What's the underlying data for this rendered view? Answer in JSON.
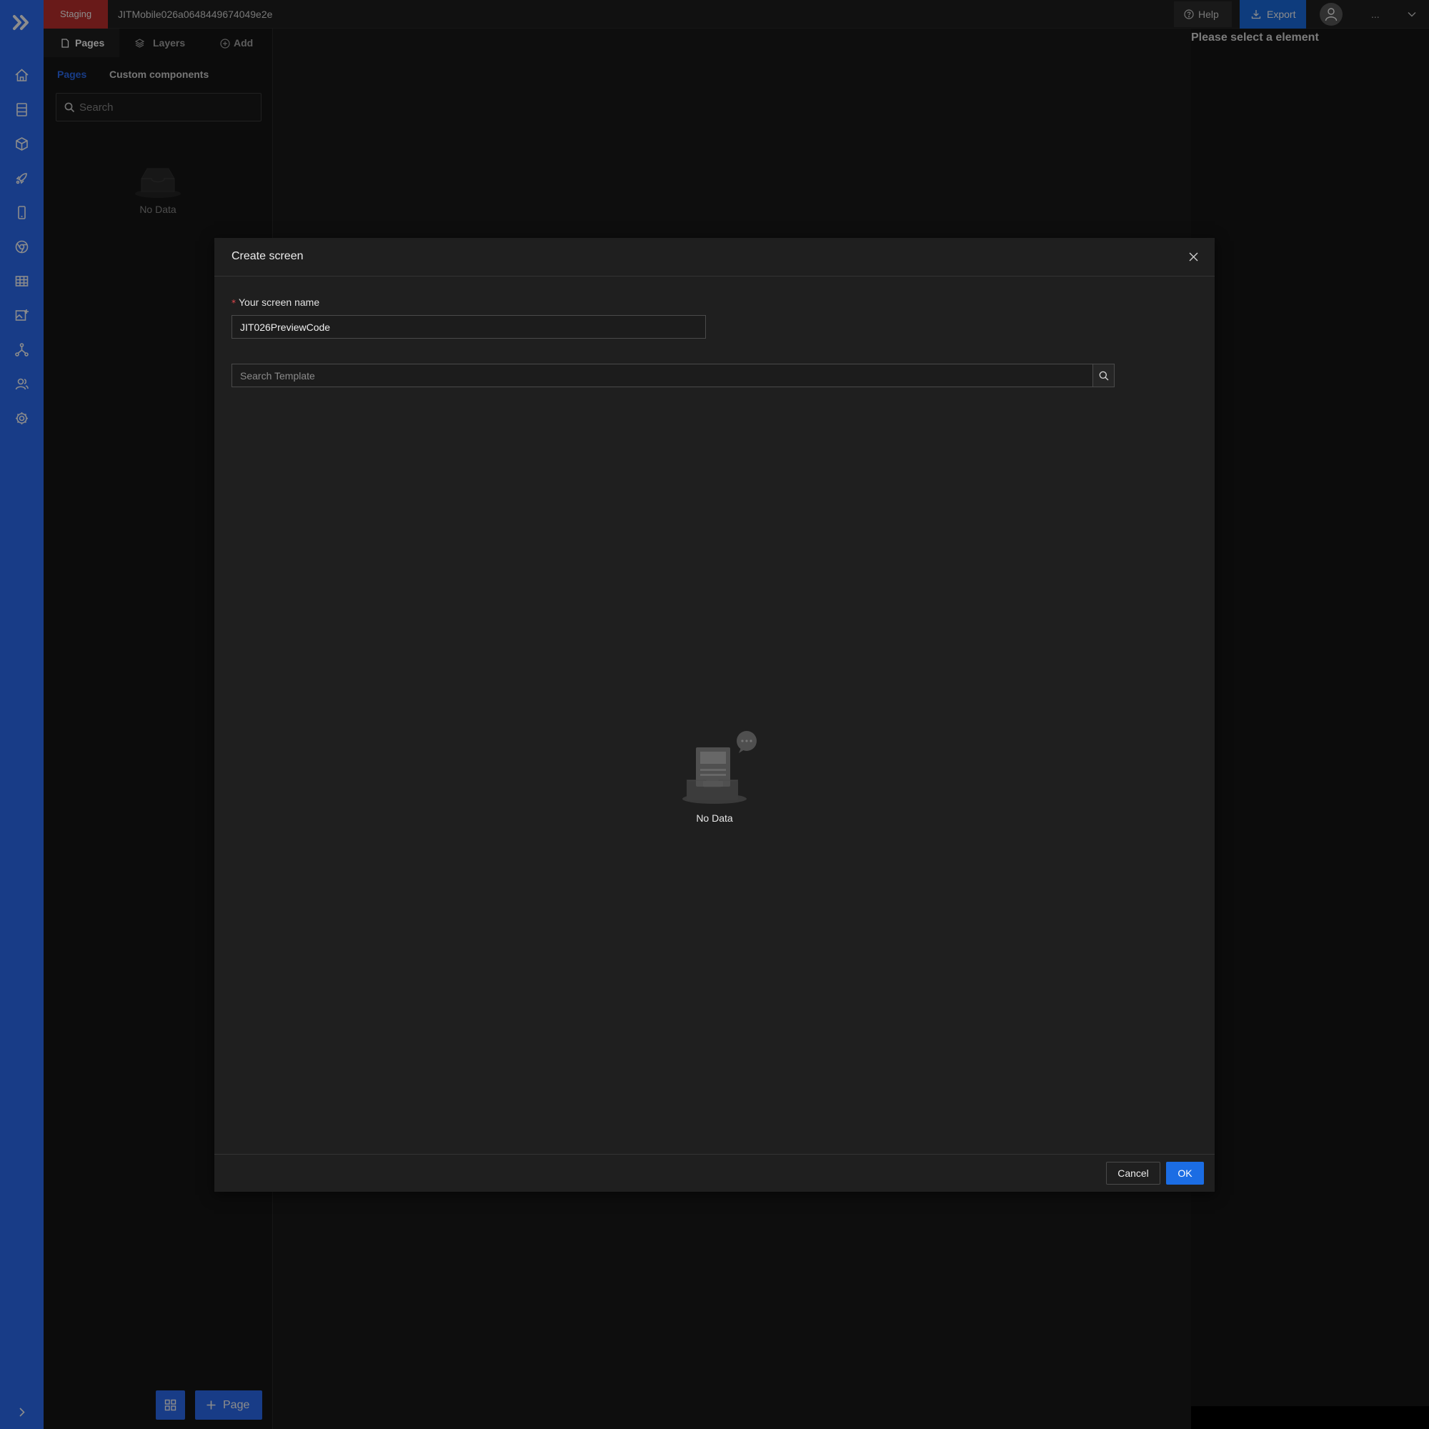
{
  "topbar": {
    "environment": "Staging",
    "app_name": "JITMobile026a0648449674049e2e",
    "help_label": "Help",
    "export_label": "Export",
    "more_label": "..."
  },
  "rail": {
    "items": [
      "home-icon",
      "database-icon",
      "cube-icon",
      "rocket-icon",
      "mobile-icon",
      "chrome-icon",
      "table-icon",
      "image-add-icon",
      "network-icon",
      "user-group-icon",
      "settings-icon"
    ]
  },
  "left_panel": {
    "tabs": {
      "pages": "Pages",
      "layers": "Layers",
      "add": "Add"
    },
    "subtabs": {
      "pages": "Pages",
      "custom": "Custom components"
    },
    "search_placeholder": "Search",
    "empty_text": "No Data",
    "add_page_label": "Page"
  },
  "right_panel": {
    "message": "Please select a element"
  },
  "modal": {
    "title": "Create screen",
    "name_label": "Your screen name",
    "name_value": "JIT026PreviewCode",
    "template_placeholder": "Search Template",
    "empty_text": "No Data",
    "cancel_label": "Cancel",
    "ok_label": "OK"
  },
  "colors": {
    "accent": "#2d6ef6",
    "primary_button": "#1b6de4",
    "environment_badge": "#c0302e",
    "required_marker": "#e5484d"
  }
}
